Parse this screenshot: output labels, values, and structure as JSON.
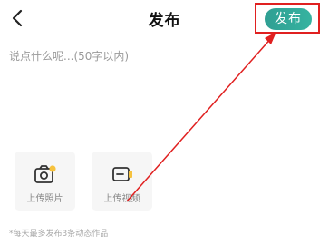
{
  "header": {
    "title": "发布",
    "back_icon": "chevron-left-icon",
    "publish_label": "发布"
  },
  "composer": {
    "placeholder": "说点什么呢...(50字以内)"
  },
  "media": {
    "photo_label": "上传照片",
    "photo_icon": "camera-plus-icon",
    "video_label": "上传视频",
    "video_icon": "video-plus-icon"
  },
  "footnote": "*每天最多发布3条动态作品",
  "colors": {
    "accent": "#34a99a",
    "annotation": "#e02020",
    "badge": "#f6c23e"
  }
}
